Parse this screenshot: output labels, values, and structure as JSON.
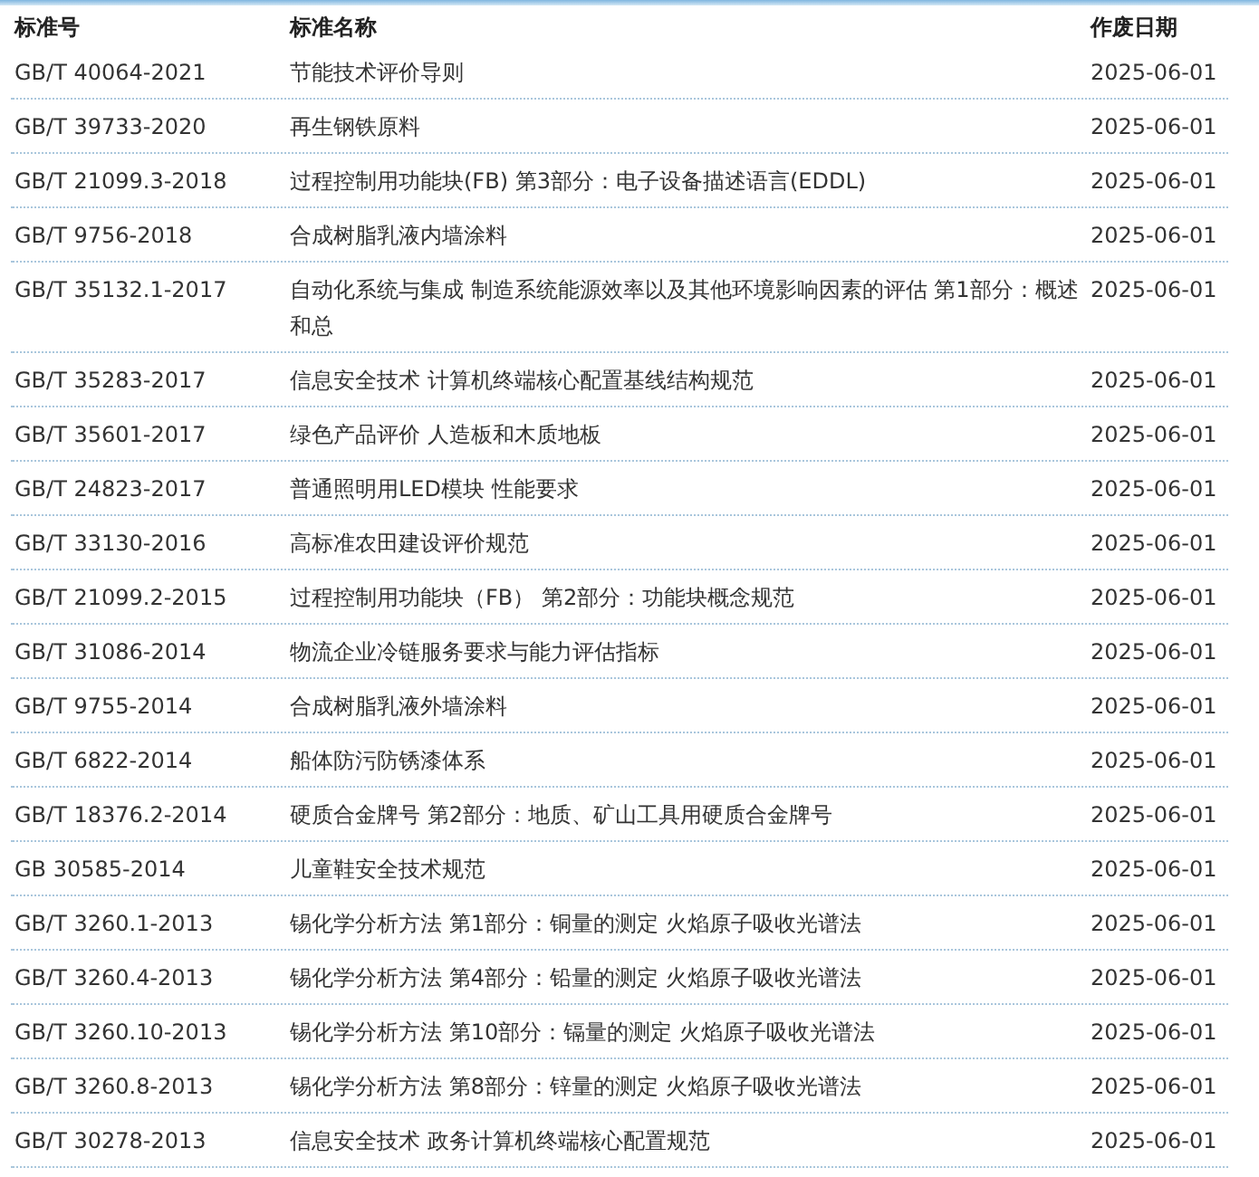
{
  "table": {
    "columns": [
      "标准号",
      "标准名称",
      "作废日期"
    ],
    "rows": [
      [
        "GB/T 40064-2021",
        "节能技术评价导则",
        "2025-06-01"
      ],
      [
        "GB/T 39733-2020",
        "再生钢铁原料",
        "2025-06-01"
      ],
      [
        "GB/T 21099.3-2018",
        "过程控制用功能块(FB) 第3部分：电子设备描述语言(EDDL)",
        "2025-06-01"
      ],
      [
        "GB/T 9756-2018",
        "合成树脂乳液内墙涂料",
        "2025-06-01"
      ],
      [
        "GB/T 35132.1-2017",
        "自动化系统与集成 制造系统能源效率以及其他环境影响因素的评估 第1部分：概述和总",
        "2025-06-01"
      ],
      [
        "GB/T 35283-2017",
        "信息安全技术 计算机终端核心配置基线结构规范",
        "2025-06-01"
      ],
      [
        "GB/T 35601-2017",
        "绿色产品评价 人造板和木质地板",
        "2025-06-01"
      ],
      [
        "GB/T 24823-2017",
        "普通照明用LED模块 性能要求",
        "2025-06-01"
      ],
      [
        "GB/T 33130-2016",
        "高标准农田建设评价规范",
        "2025-06-01"
      ],
      [
        "GB/T 21099.2-2015",
        "过程控制用功能块（FB） 第2部分：功能块概念规范",
        "2025-06-01"
      ],
      [
        "GB/T 31086-2014",
        "物流企业冷链服务要求与能力评估指标",
        "2025-06-01"
      ],
      [
        "GB/T 9755-2014",
        "合成树脂乳液外墙涂料",
        "2025-06-01"
      ],
      [
        "GB/T 6822-2014",
        "船体防污防锈漆体系",
        "2025-06-01"
      ],
      [
        "GB/T 18376.2-2014",
        "硬质合金牌号 第2部分：地质、矿山工具用硬质合金牌号",
        "2025-06-01"
      ],
      [
        "GB 30585-2014",
        "儿童鞋安全技术规范",
        "2025-06-01"
      ],
      [
        "GB/T 3260.1-2013",
        "锡化学分析方法 第1部分：铜量的测定 火焰原子吸收光谱法",
        "2025-06-01"
      ],
      [
        "GB/T 3260.4-2013",
        "锡化学分析方法 第4部分：铅量的测定 火焰原子吸收光谱法",
        "2025-06-01"
      ],
      [
        "GB/T 3260.10-2013",
        "锡化学分析方法 第10部分：镉量的测定 火焰原子吸收光谱法",
        "2025-06-01"
      ],
      [
        "GB/T 3260.8-2013",
        "锡化学分析方法 第8部分：锌量的测定 火焰原子吸收光谱法",
        "2025-06-01"
      ],
      [
        "GB/T 30278-2013",
        "信息安全技术 政务计算机终端核心配置规范",
        "2025-06-01"
      ]
    ]
  }
}
